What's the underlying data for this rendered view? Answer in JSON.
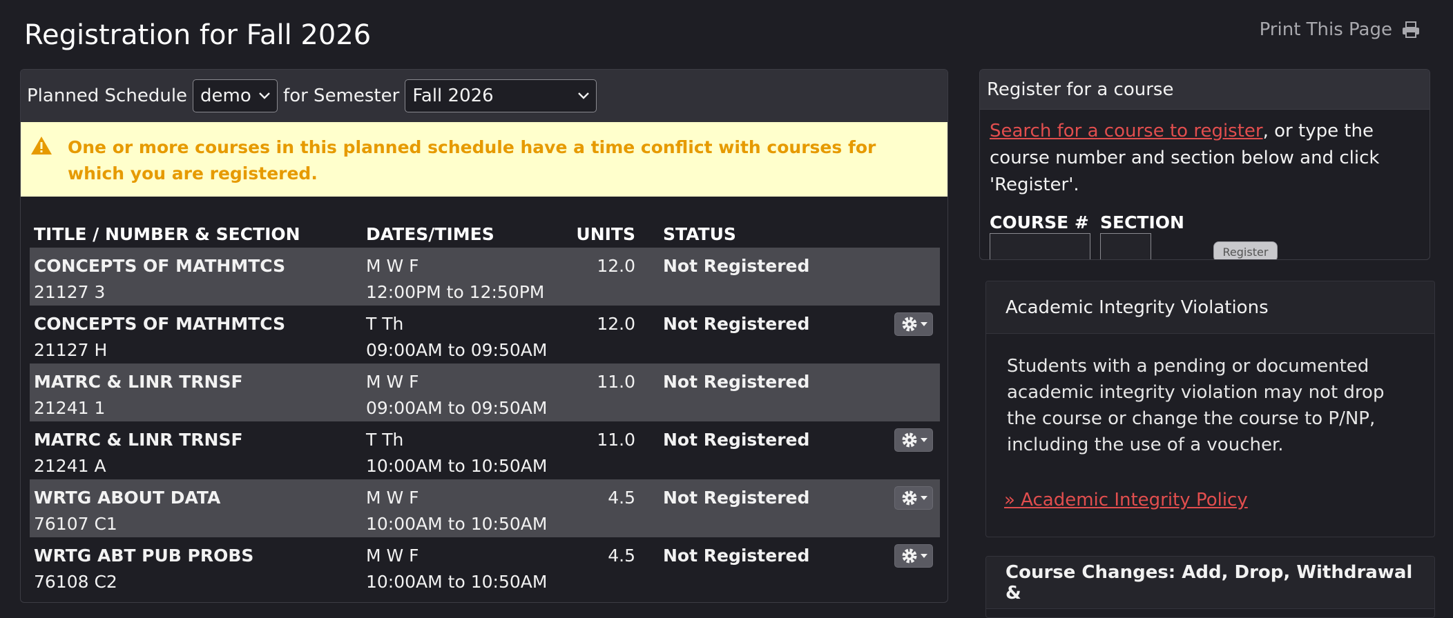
{
  "page": {
    "title": "Registration for Fall 2026",
    "print_label": "Print This Page"
  },
  "toolbar": {
    "planned_schedule_label": "Planned Schedule",
    "schedule_value": "demo",
    "for_semester_label": "for Semester",
    "semester_value": "Fall 2026"
  },
  "alert": {
    "message": "One or more courses in this planned schedule have a time conflict with courses for which you are registered."
  },
  "table": {
    "headers": {
      "title": "TITLE / NUMBER & SECTION",
      "dates": "DATES/TIMES",
      "units": "UNITS",
      "status": "STATUS"
    },
    "rows": [
      {
        "title": "CONCEPTS OF MATHMTCS",
        "number": "21127 3",
        "days": "M W F",
        "time": "12:00PM to 12:50PM",
        "units": "12.0",
        "status": "Not Registered",
        "gear": false
      },
      {
        "title": "CONCEPTS OF MATHMTCS",
        "number": "21127 H",
        "days": "T Th",
        "time": "09:00AM to 09:50AM",
        "units": "12.0",
        "status": "Not Registered",
        "gear": true
      },
      {
        "title": "MATRC & LINR TRNSF",
        "number": "21241 1",
        "days": "M W F",
        "time": "09:00AM to 09:50AM",
        "units": "11.0",
        "status": "Not Registered",
        "gear": false
      },
      {
        "title": "MATRC & LINR TRNSF",
        "number": "21241 A",
        "days": "T Th",
        "time": "10:00AM to 10:50AM",
        "units": "11.0",
        "status": "Not Registered",
        "gear": true
      },
      {
        "title": "WRTG ABOUT DATA",
        "number": "76107 C1",
        "days": "M W F",
        "time": "10:00AM to 10:50AM",
        "units": "4.5",
        "status": "Not Registered",
        "gear": true
      },
      {
        "title": "WRTG ABT PUB PROBS",
        "number": "76108 C2",
        "days": "M W F",
        "time": "10:00AM to 10:50AM",
        "units": "4.5",
        "status": "Not Registered",
        "gear": true
      }
    ]
  },
  "register": {
    "header": "Register for a course",
    "search_link": "Search for a course to register",
    "instructions": ", or type the course number and section below and click 'Register'.",
    "course_label": "COURSE #",
    "section_label": "SECTION",
    "button_label": "Register"
  },
  "integrity": {
    "header": "Academic Integrity Violations",
    "body": "Students with a pending or documented academic integrity violation may not drop the course or change the course to P/NP, including the use of a voucher.",
    "link": "» Academic Integrity Policy"
  },
  "course_changes": {
    "header": "Course Changes: Add, Drop, Withdrawal &"
  },
  "colors": {
    "background": "#1e1e24",
    "alert_bg": "#ffffcc",
    "alert_text": "#e69a00",
    "link": "#e24e4e",
    "row_shade": "#4a4a50"
  },
  "icons": {
    "print": "printer-icon",
    "warning": "warning-icon",
    "gear": "gear-icon",
    "chevron": "chevron-down-icon"
  }
}
